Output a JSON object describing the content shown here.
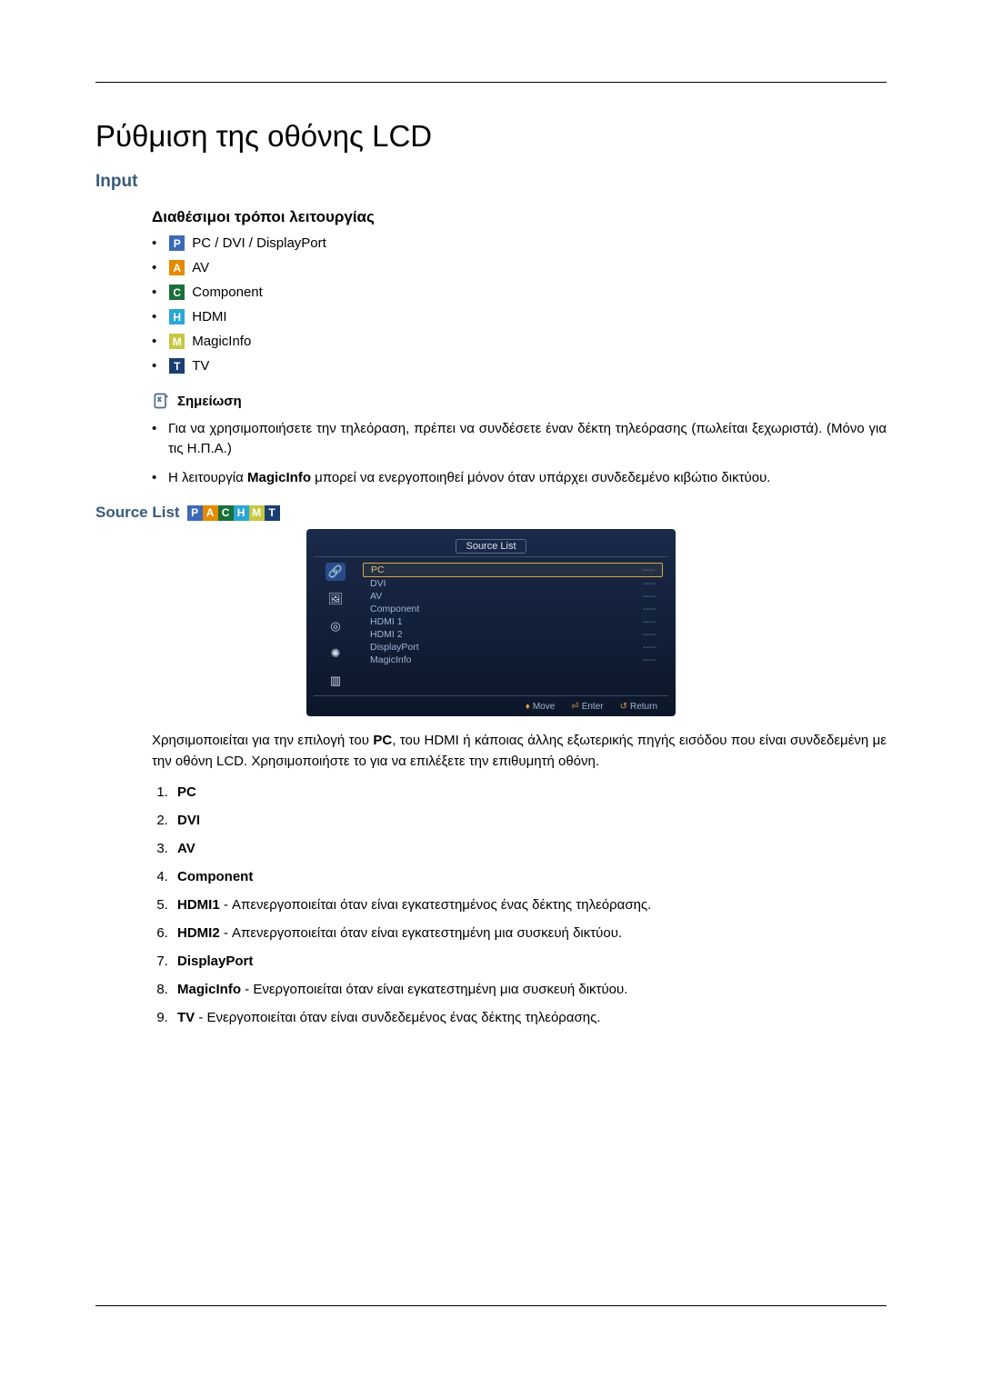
{
  "title": "Ρύθμιση της οθόνης LCD",
  "section_input": "Input",
  "subsection_modes": "Διαθέσιμοι τρόποι λειτουργίας",
  "modes": {
    "pc": "PC / DVI / DisplayPort",
    "av": "AV",
    "component": "Component",
    "hdmi": "HDMI",
    "magicinfo": "MagicInfo",
    "tv": "TV"
  },
  "note_label": "Σημείωση",
  "notes": {
    "n1": "Για να χρησιμοποιήσετε την τηλεόραση, πρέπει να συνδέσετε έναν δέκτη τηλεόρασης (πωλείται ξεχωριστά). (Μόνο για τις Η.Π.Α.)",
    "n2_a": "Η λειτουργία ",
    "n2_b": "MagicInfo",
    "n2_c": " μπορεί να ενεργοποιηθεί μόνον όταν υπάρχει συνδεδεμένο κιβώτιο δικτύου."
  },
  "source_list_label": "Source List",
  "osd": {
    "title": "Source List",
    "items": [
      {
        "name": "PC",
        "val": "----",
        "selected": true
      },
      {
        "name": "DVI",
        "val": "----",
        "selected": false
      },
      {
        "name": "AV",
        "val": "----",
        "selected": false
      },
      {
        "name": "Component",
        "val": "----",
        "selected": false
      },
      {
        "name": "HDMI 1",
        "val": "----",
        "selected": false
      },
      {
        "name": "HDMI 2",
        "val": "----",
        "selected": false
      },
      {
        "name": "DisplayPort",
        "val": "----",
        "selected": false
      },
      {
        "name": "MagicInfo",
        "val": "----",
        "selected": false
      }
    ],
    "foot_move": "Move",
    "foot_enter": "Enter",
    "foot_return": "Return"
  },
  "para_a": "Χρησιμοποιείται για την επιλογή του ",
  "para_b": "PC",
  "para_c": ", του HDMI ή κάποιας άλλης εξωτερικής πηγής εισόδου που είναι συνδεδεμένη με την οθόνη LCD. Χρησιμοποιήστε το για να επιλέξετε την επιθυμητή οθόνη.",
  "list": {
    "i1": "PC",
    "i2": "DVI",
    "i3": "AV",
    "i4": "Component",
    "i5a": "HDMI1",
    "i5b": " - Απενεργοποιείται όταν είναι εγκατεστημένος ένας δέκτης τηλεόρασης.",
    "i6a": "HDMI2",
    "i6b": " - Απενεργοποιείται όταν είναι εγκατεστημένη μια συσκευή δικτύου.",
    "i7": "DisplayPort",
    "i8a": "MagicInfo",
    "i8b": " - Ενεργοποιείται όταν είναι εγκατεστημένη μια συσκευή δικτύου.",
    "i9a": "TV",
    "i9b": " - Ενεργοποιείται όταν είναι συνδεδεμένος ένας δέκτης τηλεόρασης."
  },
  "badges": {
    "P": "P",
    "A": "A",
    "C": "C",
    "H": "H",
    "M": "M",
    "T": "T"
  },
  "icons": {
    "ic1": "🔗",
    "ic2": "🖼",
    "ic3": "◎",
    "ic4": "✺",
    "ic5": "▥"
  }
}
